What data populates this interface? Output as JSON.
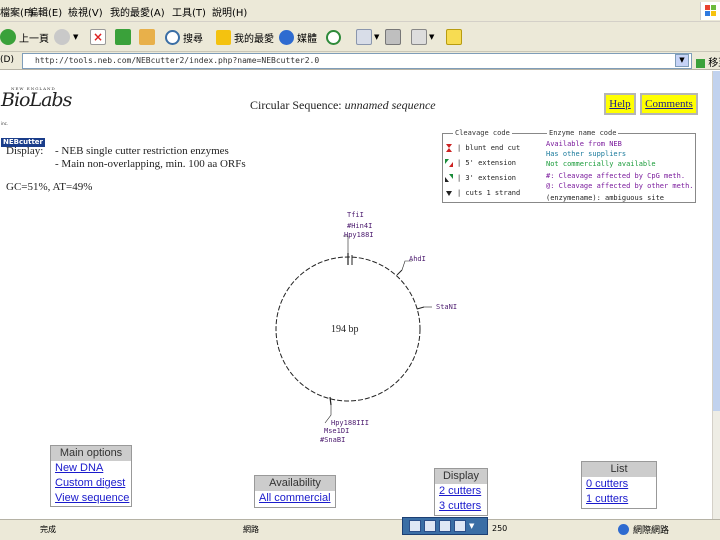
{
  "colors": {
    "accent_yellow": "#ffff00",
    "link_blue": "#1a1acc",
    "map_label": "#4b1a6e",
    "chrome": "#ece9d8"
  },
  "browser": {
    "menu": [
      "檔案(F)",
      "編輯(E)",
      "檢視(V)",
      "我的最愛(A)",
      "工具(T)",
      "說明(H)"
    ],
    "toolbar": {
      "back": "上一頁",
      "search": "搜尋",
      "favorites": "我的最愛",
      "media": "媒體"
    },
    "address": {
      "label": "(D)",
      "url": "http://tools.neb.com/NEBcutter2/index.php?name=NEBcutter2.0",
      "go": "移至"
    }
  },
  "page": {
    "logo": {
      "top": "NEW ENGLAND",
      "main": "BioLabs",
      "tm": "inc.",
      "badge": "NEBcutter"
    },
    "title_prefix": "Circular Sequence:",
    "title_name": "unnamed sequence",
    "help": "Help",
    "comments": "Comments",
    "display_label": "Display:",
    "display_options": [
      "- NEB single cutter restriction enzymes",
      "- Main non-overlapping, min. 100 aa ORFs"
    ],
    "gc_line": "GC=51%, AT=49%"
  },
  "legend": {
    "left_title": "Cleavage code",
    "right_title": "Enzyme name code",
    "left_rows": [
      {
        "icon": "blunt-end-icon",
        "text": "| blunt end cut",
        "color": "#cc2222"
      },
      {
        "icon": "five-prime-icon",
        "text": "| 5' extension",
        "color": "#1a8c3a"
      },
      {
        "icon": "three-prime-icon",
        "text": "| 3' extension",
        "color": "#1a8c3a"
      },
      {
        "icon": "cuts-one-strand-icon",
        "text": "| cuts 1 strand",
        "color": "#222222"
      }
    ],
    "right_rows": [
      {
        "text": "Available from NEB",
        "color": "#7a1a9c"
      },
      {
        "text": "Has other suppliers",
        "color": "#1a7a9c"
      },
      {
        "text": "Not commercially available",
        "color": "#1a9c3a"
      },
      {
        "text": "#: Cleavage affected by CpG meth.",
        "color": "#7a1a9c"
      },
      {
        "text": "@: Cleavage affected by other meth.",
        "color": "#7a1a9c"
      },
      {
        "text": "(enzymename): ambiguous site",
        "color": "#222222"
      }
    ]
  },
  "plasmid": {
    "length_label": "194 bp",
    "enzymes_top": [
      "TfiI",
      "#Hin4I",
      "Hpy188I"
    ],
    "enzyme_ahdi": "AhdI",
    "enzyme_stani": "StaNI",
    "enzymes_bottom": [
      "Hpy188III",
      "Mse1DI",
      "#SnaBI"
    ]
  },
  "menus": {
    "main": {
      "title": "Main options",
      "items": [
        "New DNA",
        "Custom digest",
        "View sequence"
      ]
    },
    "availability": {
      "title": "Availability",
      "items": [
        "All commercial"
      ]
    },
    "display": {
      "title": "Display",
      "items": [
        "2 cutters",
        "3 cutters"
      ]
    },
    "list": {
      "title": "List",
      "items": [
        "0 cutters",
        "1 cutters"
      ]
    }
  },
  "status": {
    "left": "完成",
    "mid": "網路",
    "right": "網際網路",
    "right2": "250"
  }
}
